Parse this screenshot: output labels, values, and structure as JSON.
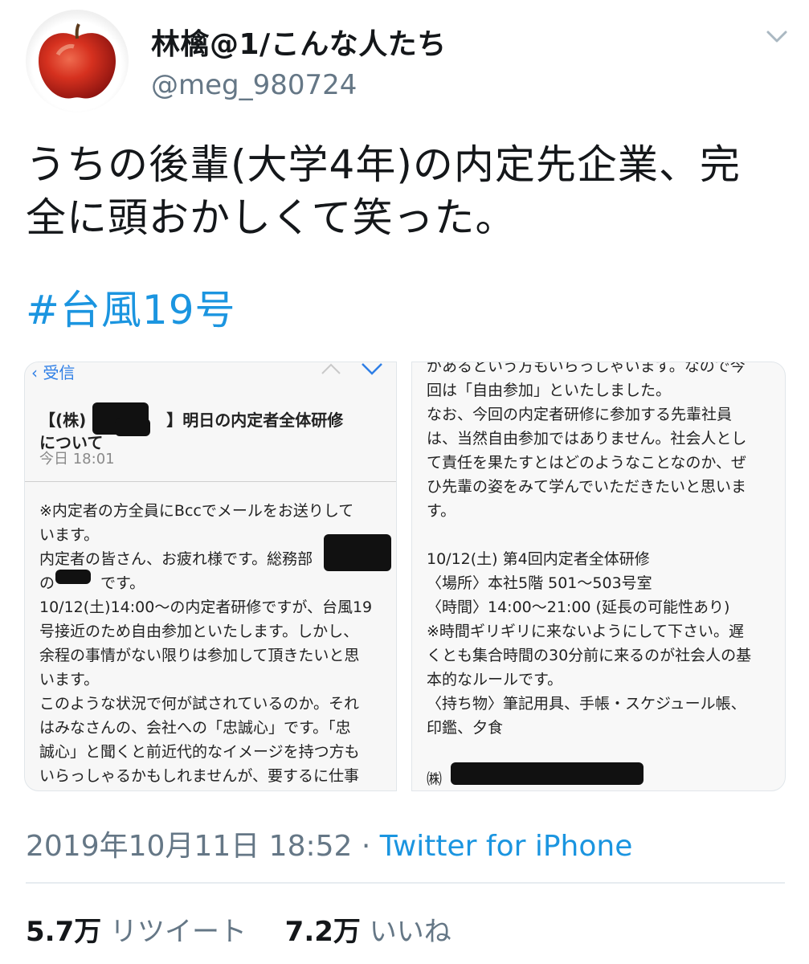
{
  "author": {
    "display_name": "林檎@1/こんな人たち",
    "handle": "@meg_980724",
    "avatar_icon": "apple-avatar-icon"
  },
  "menu_icon": "chevron-down-icon",
  "tweet": {
    "text_line1": "うちの後輩(大学4年)の内定先企業、完",
    "text_line2": "全に頭おかしくて笑った。",
    "hashtag": "#台風19号"
  },
  "image_left": {
    "back_label": "受信",
    "subject_line1": "【(株)　　　　　】明日の内定者全体研修",
    "subject_line2": "について",
    "date": "今日 18:01",
    "body_lines": [
      "※内定者の方全員にBccでメールをお送りして",
      "います。",
      "内定者の皆さん、お疲れ様です。総務部",
      "の　　　です。",
      "10/12(土)14:00～の内定者研修ですが、台風19",
      "号接近のため自由参加といたします。しかし、",
      "余程の事情がない限りは参加して頂きたいと思",
      "います。",
      "このような状況で何が試されているのか。それ",
      "はみなさんの、会社への「忠誠心」です。「忠",
      "誠心」と聞くと前近代的なイメージを持つ方も",
      "いらっしゃるかもしれませんが、要するに仕事"
    ]
  },
  "image_right": {
    "body_lines": [
      "があるという方もいらっしゃいます。なので今",
      "回は「自由参加」といたしました。",
      "なお、今回の内定者研修に参加する先輩社員",
      "は、当然自由参加ではありません。社会人とし",
      "て責任を果たすとはどのようなことなのか、ぜ",
      "ひ先輩の姿をみて学んでいただきたいと思いま",
      "す。",
      "",
      "10/12(土) 第4回内定者全体研修",
      "〈場所〉本社5階 501～503号室",
      "〈時間〉14:00～21:00 (延長の可能性あり)",
      "※時間ギリギリに来ないようにして下さい。遅",
      "くとも集合時間の30分前に来るのが社会人の基",
      "本的なルールです。",
      "〈持ち物〉筆記用具、手帳・スケジュール帳、",
      "印鑑、夕食"
    ],
    "signature": "㈱"
  },
  "meta": {
    "timestamp": "2019年10月11日 18:52",
    "separator": "·",
    "source": "Twitter for iPhone"
  },
  "stats": {
    "retweets_count": "5.7万",
    "retweets_label": "リツイート",
    "likes_count": "7.2万",
    "likes_label": "いいね"
  },
  "colors": {
    "link_blue": "#1b95e0",
    "secondary_gray": "#657786",
    "text": "#14171a"
  }
}
